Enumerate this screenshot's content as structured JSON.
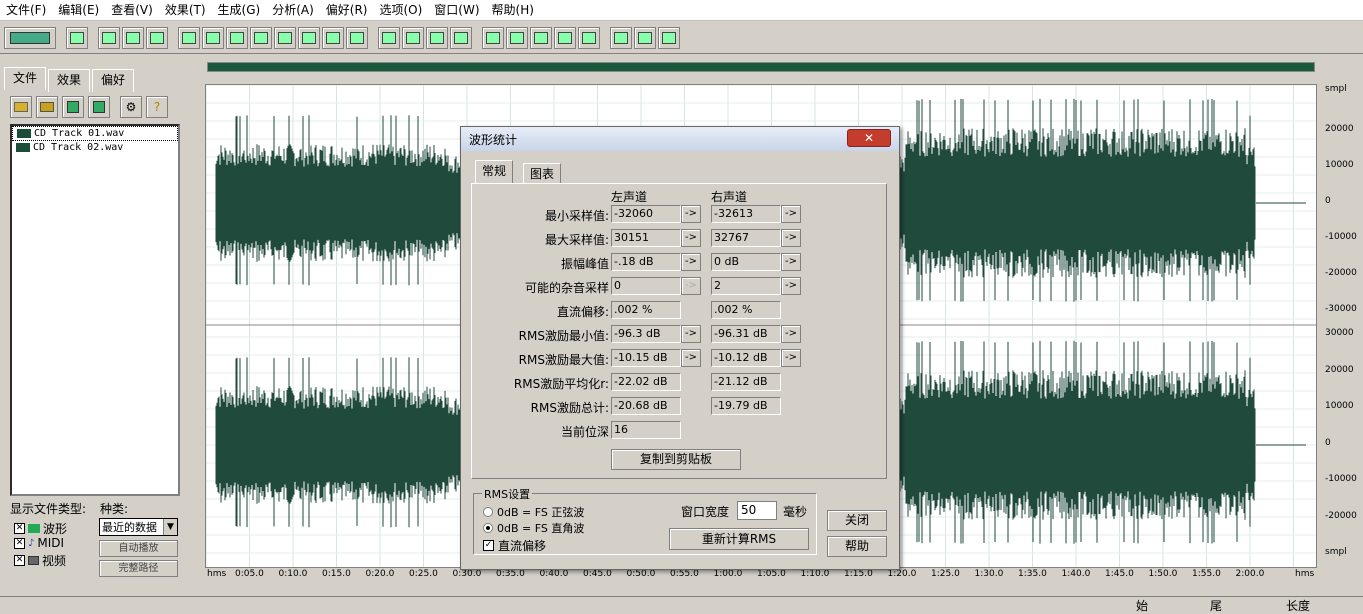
{
  "menu": [
    "文件(F)",
    "编辑(E)",
    "查看(V)",
    "效果(T)",
    "生成(G)",
    "分析(A)",
    "偏好(R)",
    "选项(O)",
    "窗口(W)",
    "帮助(H)"
  ],
  "left_panel": {
    "tabs": [
      "文件",
      "效果",
      "偏好"
    ],
    "files": [
      "CD Track 01.wav",
      "CD Track 02.wav"
    ],
    "display_type_label": "显示文件类型:",
    "kind_label": "种类:",
    "types": [
      "波形",
      "MIDI",
      "视频"
    ],
    "kind_value": "最近的数据",
    "auto_play": "自动播放",
    "full_path": "完整路径"
  },
  "ruler": {
    "unit_top": "smpl",
    "labels_top": [
      "20000",
      "10000",
      "0",
      "-10000",
      "-20000",
      "-30000"
    ],
    "labels_bottom": [
      "30000",
      "20000",
      "10000",
      "0",
      "-10000",
      "-20000",
      "smpl"
    ],
    "time_start": "hms",
    "time_end": "hms",
    "times": [
      "0:05.0",
      "0:10.0",
      "0:15.0",
      "0:20.0",
      "0:25.0",
      "0:30.0",
      "0:35.0",
      "0:40.0",
      "0:45.0",
      "0:50.0",
      "0:55.0",
      "1:00.0",
      "1:05.0",
      "1:10.0",
      "1:15.0",
      "1:20.0",
      "1:25.0",
      "1:30.0",
      "1:35.0",
      "1:40.0",
      "1:45.0",
      "1:50.0",
      "1:55.0",
      "2:00.0"
    ]
  },
  "bottom": {
    "start": "始",
    "end": "尾",
    "length": "长度"
  },
  "dialog": {
    "title": "波形统计",
    "close_x": "✕",
    "tab_general": "常规",
    "tab_chart": "图表",
    "left_channel": "左声道",
    "right_channel": "右声道",
    "rows": [
      {
        "label": "最小采样值:",
        "left": "-32060",
        "right": "-32613",
        "lbtn": true,
        "rbtn": true
      },
      {
        "label": "最大采样值:",
        "left": "30151",
        "right": "32767",
        "lbtn": true,
        "rbtn": true
      },
      {
        "label": "振幅峰值",
        "left": "-.18 dB",
        "right": "0 dB",
        "lbtn": true,
        "rbtn": true
      },
      {
        "label": "可能的杂音采样",
        "left": "0",
        "right": "2",
        "lbtn": "dis",
        "rbtn": true
      },
      {
        "label": "直流偏移:",
        "left": ".002 %",
        "right": ".002 %",
        "lbtn": false,
        "rbtn": false
      },
      {
        "label": "RMS激励最小值:",
        "left": "-96.3 dB",
        "right": "-96.31 dB",
        "lbtn": true,
        "rbtn": true
      },
      {
        "label": "RMS激励最大值:",
        "left": "-10.15 dB",
        "right": "-10.12 dB",
        "lbtn": true,
        "rbtn": true
      },
      {
        "label": "RMS激励平均化r:",
        "left": "-22.02 dB",
        "right": "-21.12 dB",
        "lbtn": false,
        "rbtn": false
      },
      {
        "label": "RMS激励总计:",
        "left": "-20.68 dB",
        "right": "-19.79 dB",
        "lbtn": false,
        "rbtn": false
      },
      {
        "label": "当前位深",
        "left": "16",
        "right": null,
        "lbtn": false,
        "rbtn": false
      }
    ],
    "arrow": "->",
    "copy_button": "复制到剪贴板",
    "rms_group": "RMS设置",
    "radio_sine": "0dB = FS 正弦波",
    "radio_square": "0dB = FS 直角波",
    "dc_offset": "直流偏移",
    "window_width_label": "窗口宽度",
    "window_width_value": "50",
    "ms_label": "毫秒",
    "recalc_button": "重新计算RMS",
    "close_button": "关闭",
    "help_button": "帮助"
  }
}
